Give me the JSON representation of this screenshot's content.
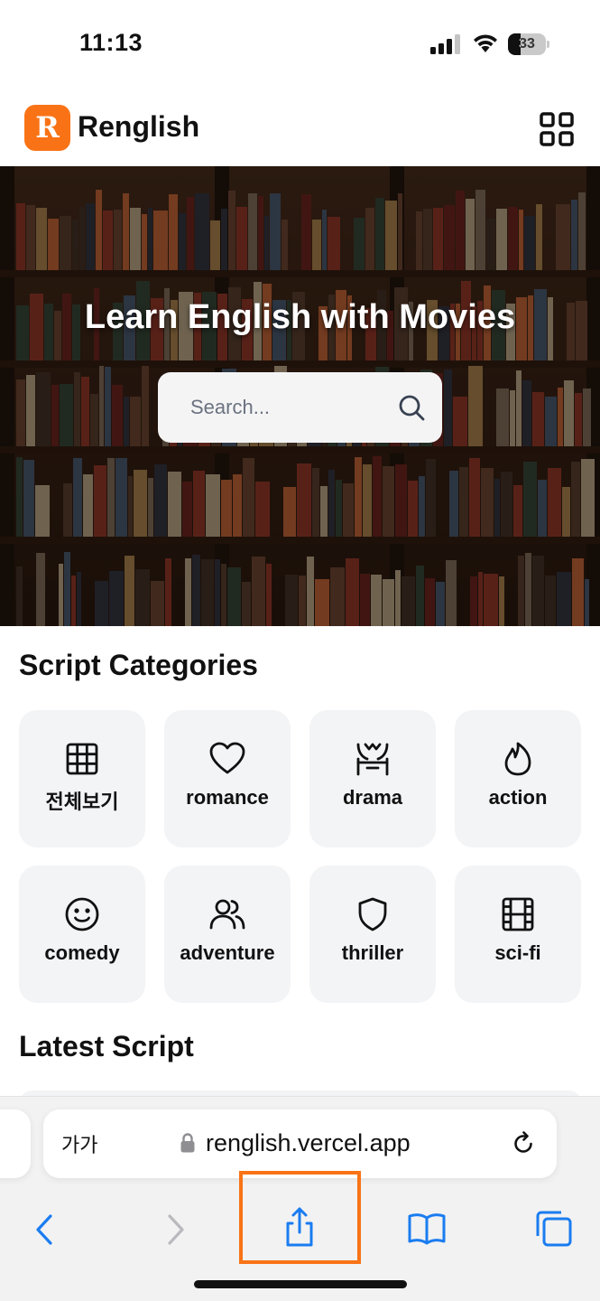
{
  "status_bar": {
    "time": "11:13",
    "battery_level": "33",
    "battery_fraction": 0.33
  },
  "header": {
    "logo_letter": "R",
    "brand": "Renglish",
    "menu_icon": "grid-icon",
    "accent_color": "#f97316"
  },
  "hero": {
    "title": "Learn English with Movies",
    "search_placeholder": "Search...",
    "search_icon": "search-icon"
  },
  "categories": {
    "title": "Script Categories",
    "items": [
      {
        "label": "전체보기",
        "icon": "grid-icon"
      },
      {
        "label": "romance",
        "icon": "heart-icon"
      },
      {
        "label": "drama",
        "icon": "theater-icon"
      },
      {
        "label": "action",
        "icon": "flame-icon"
      },
      {
        "label": "comedy",
        "icon": "smile-icon"
      },
      {
        "label": "adventure",
        "icon": "users-icon"
      },
      {
        "label": "thriller",
        "icon": "shield-icon"
      },
      {
        "label": "sci-fi",
        "icon": "film-icon"
      }
    ]
  },
  "latest": {
    "title": "Latest Script"
  },
  "browser": {
    "aa_label": "가가",
    "url": "renglish.vercel.app",
    "toolbar": [
      "back-icon",
      "forward-icon",
      "share-icon",
      "bookmarks-icon",
      "tabs-icon"
    ],
    "highlight_color": "#f97316",
    "link_color": "#1a7cf0"
  }
}
